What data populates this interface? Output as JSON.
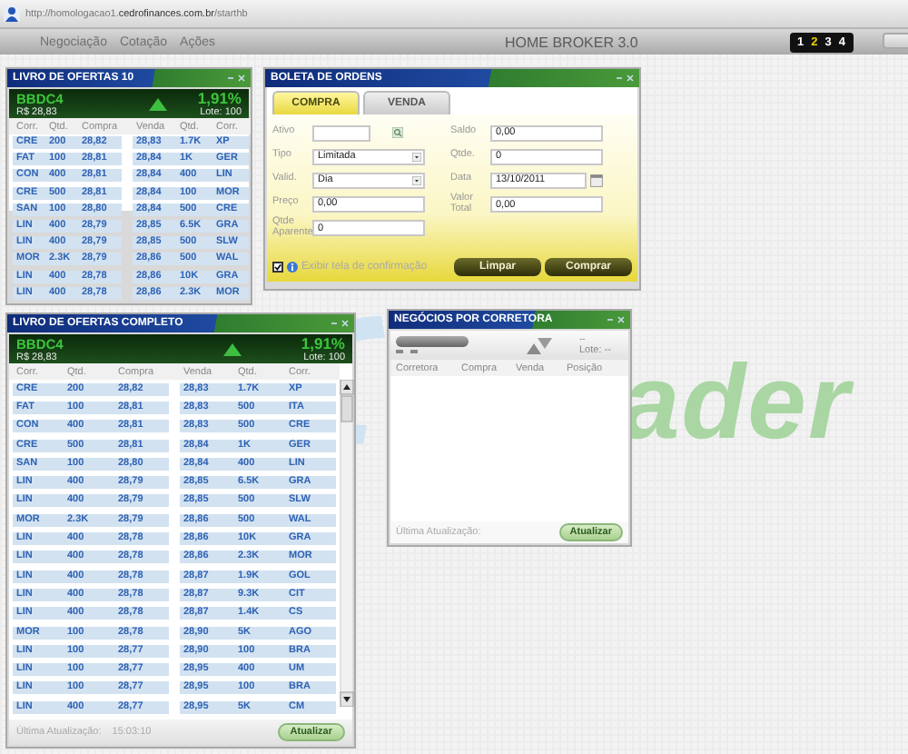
{
  "browser": {
    "url": "http://homologacao1.**cedrofinances.com.br**/starthb"
  },
  "nav": {
    "items": [
      "Negociação",
      "Cotação",
      "Ações"
    ],
    "title": "HOME BROKER 3.0",
    "pages": [
      {
        "label": "1",
        "selected": false
      },
      {
        "label": "2",
        "selected": true
      },
      {
        "label": "3",
        "selected": false
      },
      {
        "label": "4",
        "selected": false
      }
    ]
  },
  "background_logo": {
    "text": "ader"
  },
  "book10": {
    "title": "LIVRO DE OFERTAS 10",
    "symbol": "BBDC4",
    "price": "R$ 28,83",
    "trend": {
      "kind": "up"
    },
    "change": "1,91%",
    "lot": "Lote: 100",
    "columns": [
      "Corr.",
      "Qtd.",
      "Compra",
      "Venda",
      "Qtd.",
      "Corr."
    ],
    "rows": [
      [
        "CRE",
        "200",
        "28,82",
        "28,83",
        "1.7K",
        "XP"
      ],
      [
        "FAT",
        "100",
        "28,81",
        "28,84",
        "1K",
        "GER"
      ],
      [
        "CON",
        "400",
        "28,81",
        "28,84",
        "400",
        "LIN"
      ],
      [
        "CRE",
        "500",
        "28,81",
        "28,84",
        "100",
        "MOR"
      ],
      [
        "SAN",
        "100",
        "28,80",
        "28,84",
        "500",
        "CRE"
      ],
      [
        "LIN",
        "400",
        "28,79",
        "28,85",
        "6.5K",
        "GRA"
      ],
      [
        "LIN",
        "400",
        "28,79",
        "28,85",
        "500",
        "SLW"
      ],
      [
        "MOR",
        "2.3K",
        "28,79",
        "28,86",
        "500",
        "WAL"
      ],
      [
        "LIN",
        "400",
        "28,78",
        "28,86",
        "10K",
        "GRA"
      ],
      [
        "LIN",
        "400",
        "28,78",
        "28,86",
        "2.3K",
        "MOR"
      ]
    ]
  },
  "order_ticket": {
    "title": "BOLETA DE ORDENS",
    "tabs": [
      {
        "label": "COMPRA",
        "selected": true
      },
      {
        "label": "VENDA",
        "selected": false
      }
    ],
    "left_fields": [
      {
        "label": "Ativo",
        "kind": "search"
      },
      {
        "label": "Tipo",
        "kind": "select",
        "value": "Limitada"
      },
      {
        "label": "Valid.",
        "kind": "select",
        "value": "Dia"
      },
      {
        "label": "Preço",
        "kind": "text",
        "value": "0,00"
      },
      {
        "label": "Qtde Aparente",
        "kind": "text",
        "value": "0"
      }
    ],
    "right_fields": [
      {
        "label": "Saldo",
        "kind": "text",
        "value": "0,00"
      },
      {
        "label": "Qtde.",
        "kind": "text",
        "value": "0"
      },
      {
        "label": "Data",
        "kind": "date",
        "value": "13/10/2011"
      },
      {
        "label": "Valor Total",
        "kind": "text",
        "value": "0,00"
      }
    ],
    "confirm": {
      "label": "Exibir tela de confirmação",
      "checked": true
    },
    "buttons": [
      "Limpar",
      "Comprar"
    ]
  },
  "book_full": {
    "title": "LIVRO DE OFERTAS COMPLETO",
    "symbol": "BBDC4",
    "price": "R$ 28,83",
    "trend": {
      "kind": "up"
    },
    "change": "1,91%",
    "lot": "Lote: 100",
    "columns": [
      "Corr.",
      "Qtd.",
      "Compra",
      "Venda",
      "Qtd.",
      "Corr."
    ],
    "rows": [
      [
        "CRE",
        "200",
        "28,82",
        "28,83",
        "1.7K",
        "XP"
      ],
      [
        "FAT",
        "100",
        "28,81",
        "28,83",
        "500",
        "ITA"
      ],
      [
        "CON",
        "400",
        "28,81",
        "28,83",
        "500",
        "CRE"
      ],
      [
        "CRE",
        "500",
        "28,81",
        "28,84",
        "1K",
        "GER"
      ],
      [
        "SAN",
        "100",
        "28,80",
        "28,84",
        "400",
        "LIN"
      ],
      [
        "LIN",
        "400",
        "28,79",
        "28,85",
        "6.5K",
        "GRA"
      ],
      [
        "LIN",
        "400",
        "28,79",
        "28,85",
        "500",
        "SLW"
      ],
      [
        "MOR",
        "2.3K",
        "28,79",
        "28,86",
        "500",
        "WAL"
      ],
      [
        "LIN",
        "400",
        "28,78",
        "28,86",
        "10K",
        "GRA"
      ],
      [
        "LIN",
        "400",
        "28,78",
        "28,86",
        "2.3K",
        "MOR"
      ],
      [
        "LIN",
        "400",
        "28,78",
        "28,87",
        "1.9K",
        "GOL"
      ],
      [
        "LIN",
        "400",
        "28,78",
        "28,87",
        "9.3K",
        "CIT"
      ],
      [
        "LIN",
        "400",
        "28,78",
        "28,87",
        "1.4K",
        "CS"
      ],
      [
        "MOR",
        "100",
        "28,78",
        "28,90",
        "5K",
        "AGO"
      ],
      [
        "LIN",
        "100",
        "28,77",
        "28,90",
        "100",
        "BRA"
      ],
      [
        "LIN",
        "100",
        "28,77",
        "28,95",
        "400",
        "UM"
      ],
      [
        "LIN",
        "100",
        "28,77",
        "28,95",
        "100",
        "BRA"
      ],
      [
        "LIN",
        "400",
        "28,77",
        "28,95",
        "5K",
        "CM"
      ]
    ],
    "footer": {
      "label": "Última Atualização:",
      "time": "15:03:10",
      "button": "Atualizar"
    }
  },
  "broker": {
    "title": "NEGÓCIOS POR CORRETORA",
    "trend": {
      "kind": "flat"
    },
    "change": "--",
    "lot": "Lote: --",
    "columns": [
      "Corretora",
      "Compra",
      "Venda",
      "Posição"
    ],
    "footer": {
      "label": "Última Atualização:",
      "button": "Atualizar"
    }
  }
}
